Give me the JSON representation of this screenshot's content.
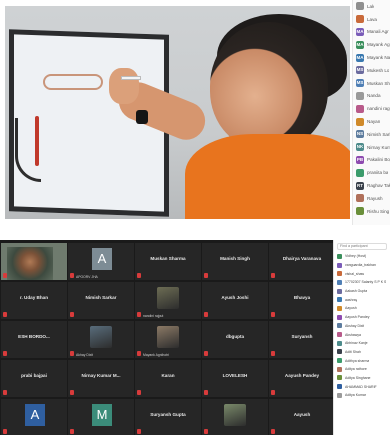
{
  "top_panel": {
    "participants": [
      {
        "initials": "",
        "name": "Lak",
        "color": "#8f8f8f"
      },
      {
        "initials": "",
        "name": "Lava",
        "color": "#c96a3a"
      },
      {
        "initials": "MA",
        "name": "Manali Agr",
        "color": "#7a5cb8"
      },
      {
        "initials": "MA",
        "name": "Mayank Agr",
        "color": "#3a8f5c"
      },
      {
        "initials": "MA",
        "name": "Mayank Na",
        "color": "#3a79b0"
      },
      {
        "initials": "MS",
        "name": "Mukesh Lo",
        "color": "#6b6b9e"
      },
      {
        "initials": "MS",
        "name": "Muskan Sh",
        "color": "#4f7fb5"
      },
      {
        "initials": "",
        "name": "Nanda",
        "color": "#9a9a9a"
      },
      {
        "initials": "",
        "name": "nandini ragg",
        "color": "#b85a8a"
      },
      {
        "initials": "",
        "name": "Nayan",
        "color": "#d08a2a"
      },
      {
        "initials": "NS",
        "name": "Nimish Sark",
        "color": "#5d7c9e"
      },
      {
        "initials": "NK",
        "name": "Nirnay Kuma",
        "color": "#4d8b8b"
      },
      {
        "initials": "PB",
        "name": "Pakalini Bojh",
        "color": "#8e4bb0"
      },
      {
        "initials": "",
        "name": "praniita ba",
        "color": "#3b9b6b"
      },
      {
        "initials": "RT",
        "name": "Raghav Tak",
        "color": "#39404a"
      },
      {
        "initials": "",
        "name": "Rayush",
        "color": "#b0705a"
      },
      {
        "initials": "",
        "name": "Rishu Sing",
        "color": "#6a8f3a"
      }
    ]
  },
  "gallery": {
    "tiles": [
      {
        "name": "",
        "sub": "",
        "kind": "video"
      },
      {
        "name": "",
        "sub": "APOORV JHA",
        "kind": "avatar",
        "letter": "A",
        "color": "#7d8c95"
      },
      {
        "name": "Muskan Sharma",
        "sub": "",
        "kind": "name"
      },
      {
        "name": "Manish Singh",
        "sub": "",
        "kind": "name"
      },
      {
        "name": "Dhairya Varanava",
        "sub": "",
        "kind": "name"
      },
      {
        "name": "r. Uday Bhan",
        "sub": "",
        "kind": "name"
      },
      {
        "name": "Nimish Sarkar",
        "sub": "",
        "kind": "name"
      },
      {
        "name": "",
        "sub": "nandini rajput",
        "kind": "thumb",
        "color": "#6d6d54"
      },
      {
        "name": "Ayush Joshi",
        "sub": "",
        "kind": "name"
      },
      {
        "name": "Bhavya",
        "sub": "",
        "kind": "name"
      },
      {
        "name": "ESH BORDO...",
        "sub": "",
        "kind": "name"
      },
      {
        "name": "",
        "sub": "Akhay Dixit",
        "kind": "thumb",
        "color": "#596d7c"
      },
      {
        "name": "",
        "sub": "Mayank Agnihotri",
        "kind": "thumb",
        "color": "#8c7a66"
      },
      {
        "name": "dbgupta",
        "sub": "",
        "kind": "name"
      },
      {
        "name": "Suryansh",
        "sub": "",
        "kind": "name"
      },
      {
        "name": "prabi bajpai",
        "sub": "",
        "kind": "name"
      },
      {
        "name": "Nirnay Kumar M...",
        "sub": "",
        "kind": "name"
      },
      {
        "name": "Karan",
        "sub": "",
        "kind": "name"
      },
      {
        "name": "LOVELESH",
        "sub": "",
        "kind": "name"
      },
      {
        "name": "Aayush Pandey",
        "sub": "",
        "kind": "name"
      },
      {
        "name": "",
        "sub": "",
        "kind": "avatar",
        "letter": "A",
        "color": "#2f5fa0"
      },
      {
        "name": "",
        "sub": "",
        "kind": "avatar",
        "letter": "M",
        "color": "#3b8c7a"
      },
      {
        "name": "Suryansh Gupta",
        "sub": "",
        "kind": "name"
      },
      {
        "name": "",
        "sub": "",
        "kind": "thumb",
        "color": "#7a8a6a"
      },
      {
        "name": "Aayush",
        "sub": "",
        "kind": "name"
      }
    ]
  },
  "list_panel": {
    "search_placeholder": "Find a participant",
    "participants": [
      {
        "name": "Vidhey (Host)",
        "color": "#3a8f5c"
      },
      {
        "name": "vanguardia_trakhan",
        "color": "#7a5cb8"
      },
      {
        "name": "vishal_shaw",
        "color": "#c96a3a"
      },
      {
        "name": "17702307 Salanty S P K S",
        "color": "#4f7fb5"
      },
      {
        "name": "Aakash Gupta",
        "color": "#6b6b9e"
      },
      {
        "name": "aashray",
        "color": "#3a79b0"
      },
      {
        "name": "Aayush",
        "color": "#d08a2a"
      },
      {
        "name": "Aayush Pandey",
        "color": "#8e4bb0"
      },
      {
        "name": "Akshay Dixit",
        "color": "#5d7c9e"
      },
      {
        "name": "Akshawya",
        "color": "#b85a8a"
      },
      {
        "name": "Abhinav Kanje",
        "color": "#4d8b8b"
      },
      {
        "name": "Aditi Shah",
        "color": "#39404a"
      },
      {
        "name": "Adithya sharma",
        "color": "#3b9b6b"
      },
      {
        "name": "Aditya rathore",
        "color": "#b0705a"
      },
      {
        "name": "Aditya Singhane",
        "color": "#6a8f3a"
      },
      {
        "name": "AHAMMAD SHARIF",
        "color": "#2f5fa0"
      },
      {
        "name": "Aditya Kumar",
        "color": "#9a9a9a"
      }
    ]
  }
}
